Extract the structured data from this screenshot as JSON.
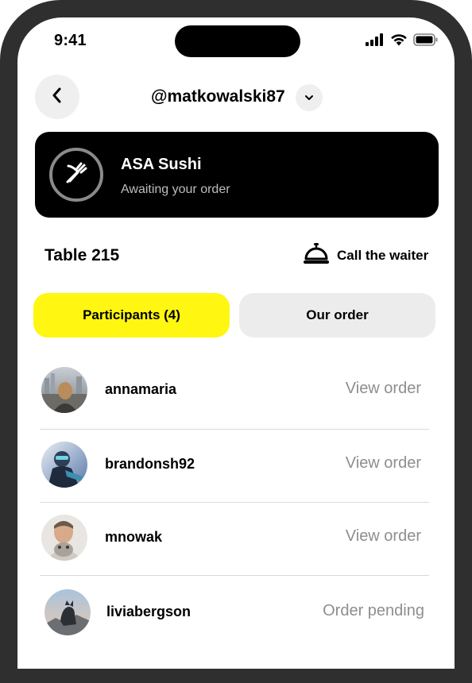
{
  "status_bar": {
    "time": "9:41",
    "icons": [
      "cellular-signal-icon",
      "wifi-icon",
      "battery-icon"
    ]
  },
  "header": {
    "back_icon": "chevron-left-icon",
    "username": "@matkowalski87",
    "dropdown_icon": "chevron-down-icon"
  },
  "restaurant": {
    "logo_icon": "fork-knife-icon",
    "name": "ASA Sushi",
    "status": "Awaiting your order"
  },
  "table": {
    "label": "Table 215",
    "call_waiter_icon": "service-bell-icon",
    "call_waiter_label": "Call the waiter"
  },
  "tabs": [
    {
      "label": "Participants (4)",
      "active": true
    },
    {
      "label": "Our order",
      "active": false
    }
  ],
  "participants": [
    {
      "name": "annamaria",
      "action": "View order",
      "avatar_icon": "avatar-photo"
    },
    {
      "name": "brandonsh92",
      "action": "View order",
      "avatar_icon": "avatar-photo"
    },
    {
      "name": "mnowak",
      "action": "View order",
      "avatar_icon": "avatar-photo"
    },
    {
      "name": "liviabergson",
      "action": "Order pending",
      "avatar_icon": "avatar-photo"
    }
  ],
  "colors": {
    "accent_yellow": "#fff612",
    "card_black": "#000000",
    "muted_text": "#8e8e8e",
    "tab_inactive": "#ececec",
    "frame": "#2f2f2f"
  }
}
